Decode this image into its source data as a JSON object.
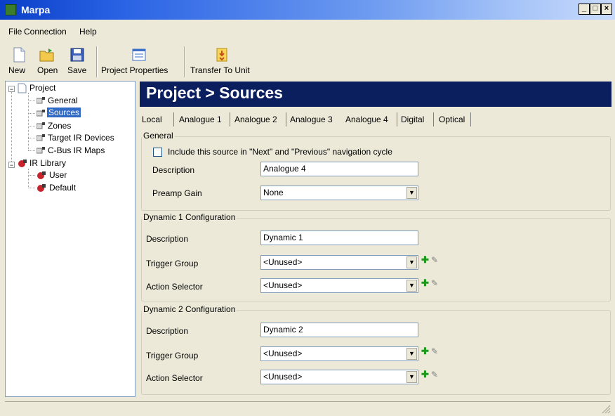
{
  "window": {
    "title": "Marpa"
  },
  "menu": [
    "File",
    "Connection",
    "Help"
  ],
  "toolbar": {
    "new": "New",
    "open": "Open",
    "save": "Save",
    "project_properties": "Project Properties",
    "transfer": "Transfer To Unit"
  },
  "tree": {
    "project": "Project",
    "general": "General",
    "sources": "Sources",
    "zones": "Zones",
    "target_ir": "Target IR Devices",
    "cbus_ir": "C-Bus IR Maps",
    "ir_library": "IR Library",
    "user": "User",
    "default": "Default"
  },
  "header": {
    "title": "Project > Sources"
  },
  "tabs": [
    "Local",
    "Analogue 1",
    "Analogue 2",
    "Analogue 3",
    "Analogue 4",
    "Digital",
    "Optical"
  ],
  "active_tab": "Analogue 4",
  "general": {
    "label": "General",
    "include_text": "Include this source in \"Next\" and \"Previous\" navigation cycle",
    "description_label": "Description",
    "description_value": "Analogue 4",
    "preamp_label": "Preamp Gain",
    "preamp_value": "None"
  },
  "dynamic1": {
    "label": "Dynamic 1 Configuration",
    "description_label": "Description",
    "description_value": "Dynamic 1",
    "trigger_label": "Trigger Group",
    "trigger_value": "<Unused>",
    "action_label": "Action Selector",
    "action_value": "<Unused>"
  },
  "dynamic2": {
    "label": "Dynamic 2 Configuration",
    "description_label": "Description",
    "description_value": "Dynamic 2",
    "trigger_label": "Trigger Group",
    "trigger_value": "<Unused>",
    "action_label": "Action Selector",
    "action_value": "<Unused>"
  },
  "icons": {
    "app": "marpa-app-icon",
    "new": "new-file-icon",
    "open": "open-folder-icon",
    "save": "floppy-save-icon",
    "properties": "properties-icon",
    "transfer": "transfer-icon",
    "add": "green-plus-icon",
    "edit": "pencil-icon"
  },
  "colors": {
    "header_bg": "#0b1f5e",
    "selection": "#316ac5",
    "titlebar": "#0a3fc9"
  }
}
